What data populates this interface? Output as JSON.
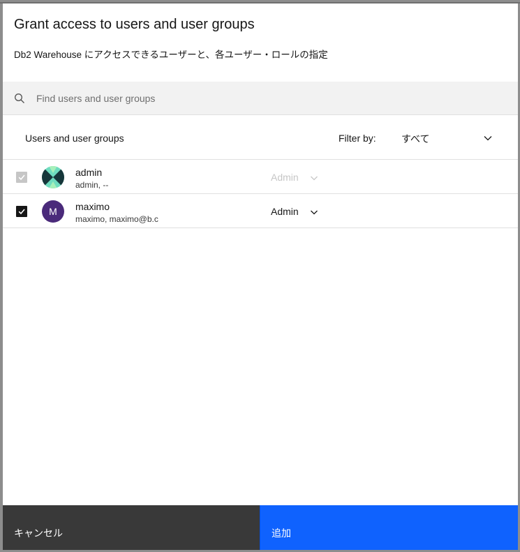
{
  "modal": {
    "title": "Grant access to users and user groups",
    "description": "Db2 Warehouse にアクセスできるユーザーと、各ユーザー・ロールの指定"
  },
  "search": {
    "placeholder": "Find users and user groups",
    "value": "",
    "icon": "search-icon"
  },
  "list": {
    "header_label": "Users and user groups",
    "filter_label": "Filter by:",
    "filter_value": "すべて",
    "filter_icon": "chevron-down-icon"
  },
  "users": [
    {
      "name": "admin",
      "subtitle": "admin, --",
      "checked": true,
      "disabled": true,
      "role": "Admin",
      "avatar": "geometric-pattern",
      "avatar_colors": [
        "#6fdcbf",
        "#1a3a3a"
      ]
    },
    {
      "name": "maximo",
      "subtitle": "maximo, maximo@b.c",
      "checked": true,
      "disabled": false,
      "role": "Admin",
      "avatar_initial": "M",
      "avatar_color": "#4a2a7a"
    }
  ],
  "footer": {
    "cancel_label": "キャンセル",
    "add_label": "追加"
  },
  "colors": {
    "primary": "#0f62fe",
    "secondary": "#393939",
    "overlay": "#8d8d8d"
  }
}
